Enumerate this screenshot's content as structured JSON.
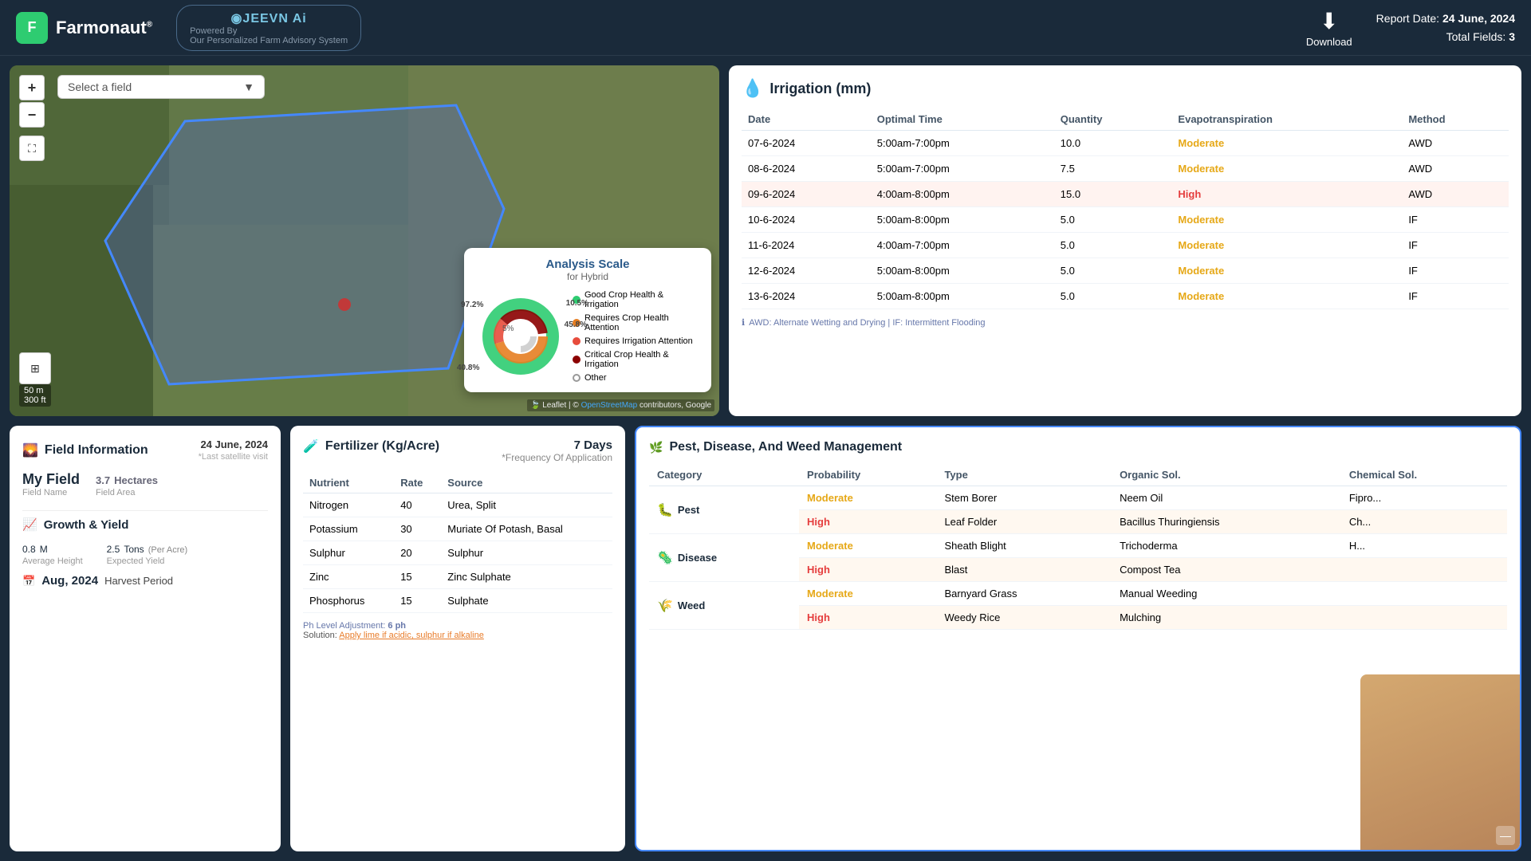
{
  "header": {
    "logo_letter": "F",
    "brand_name": "Farmonaut",
    "brand_reg": "®",
    "jeevn_label": "◉JEEVN Ai",
    "jeevn_powered": "Powered By",
    "jeevn_tagline": "Our Personalized Farm Advisory System",
    "download_label": "Download",
    "report_date_label": "Report Date:",
    "report_date_value": "24 June, 2024",
    "total_fields_label": "Total Fields:",
    "total_fields_value": "3"
  },
  "map": {
    "field_select_placeholder": "Select a field",
    "zoom_in": "+",
    "zoom_out": "−",
    "scale_m": "50 m",
    "scale_ft": "300 ft",
    "attribution": "Leaflet | © OpenStreetMap contributors, Google"
  },
  "analysis_scale": {
    "title": "Analysis Scale",
    "subtitle": "for Hybrid",
    "pct_972": "97.2%",
    "pct_105": "10.5%",
    "pct_458": "45.8%",
    "pct_408": "40.8%",
    "pct_5": "5%",
    "legend": [
      {
        "color": "#2ecc71",
        "label": "Good Crop Health & Irrigation"
      },
      {
        "color": "#e67e22",
        "label": "Requires Crop Health Attention"
      },
      {
        "color": "#e74c3c",
        "label": "Requires Irrigation Attention"
      },
      {
        "color": "#c0392b",
        "label": "Critical Crop Health & Irrigation"
      },
      {
        "color": "#cccccc",
        "label": "Other"
      }
    ]
  },
  "irrigation": {
    "title": "Irrigation (mm)",
    "icon": "💧",
    "columns": [
      "Date",
      "Optimal Time",
      "Quantity",
      "Evapotranspiration",
      "Method"
    ],
    "rows": [
      {
        "date": "07-6-2024",
        "time": "5:00am-7:00pm",
        "qty": "10.0",
        "evap": "Moderate",
        "method": "AWD",
        "highlight": false
      },
      {
        "date": "08-6-2024",
        "time": "5:00am-7:00pm",
        "qty": "7.5",
        "evap": "Moderate",
        "method": "AWD",
        "highlight": false
      },
      {
        "date": "09-6-2024",
        "time": "4:00am-8:00pm",
        "qty": "15.0",
        "evap": "High",
        "method": "AWD",
        "highlight": true
      },
      {
        "date": "10-6-2024",
        "time": "5:00am-8:00pm",
        "qty": "5.0",
        "evap": "Moderate",
        "method": "IF",
        "highlight": false
      },
      {
        "date": "11-6-2024",
        "time": "4:00am-7:00pm",
        "qty": "5.0",
        "evap": "Moderate",
        "method": "IF",
        "highlight": false
      },
      {
        "date": "12-6-2024",
        "time": "5:00am-8:00pm",
        "qty": "5.0",
        "evap": "Moderate",
        "method": "IF",
        "highlight": false
      },
      {
        "date": "13-6-2024",
        "time": "5:00am-8:00pm",
        "qty": "5.0",
        "evap": "Moderate",
        "method": "IF",
        "highlight": false
      }
    ],
    "note": "AWD: Alternate Wetting and Drying | IF: Intermittent Flooding"
  },
  "field_info": {
    "title": "Field Information",
    "icon": "🌄",
    "date_label": "24 June, 2024",
    "date_sub": "*Last satellite visit",
    "field_name_label": "My Field",
    "field_name_sub": "Field Name",
    "area_value": "3.7",
    "area_unit": "Hectares",
    "area_sub": "Field Area"
  },
  "growth": {
    "title": "Growth & Yield",
    "icon": "📈",
    "height_val": "0.8",
    "height_unit": "M",
    "height_label": "Average Height",
    "yield_val": "2.5",
    "yield_unit": "Tons",
    "yield_per": "(Per Acre)",
    "yield_label": "Expected Yield",
    "harvest_date": "Aug, 2024",
    "harvest_label": "Harvest Period"
  },
  "fertilizer": {
    "title": "Fertilizer (Kg/Acre)",
    "icon": "🧪",
    "freq_val": "7 Days",
    "freq_label": "*Frequency Of Application",
    "columns": [
      "Nutrient",
      "Rate",
      "Source"
    ],
    "rows": [
      {
        "nutrient": "Nitrogen",
        "rate": "40",
        "source": "Urea, Split"
      },
      {
        "nutrient": "Potassium",
        "rate": "30",
        "source": "Muriate Of Potash, Basal"
      },
      {
        "nutrient": "Sulphur",
        "rate": "20",
        "source": "Sulphur"
      },
      {
        "nutrient": "Zinc",
        "rate": "15",
        "source": "Zinc Sulphate"
      },
      {
        "nutrient": "Phosphorus",
        "rate": "15",
        "source": "Sulphate"
      }
    ],
    "ph_note": "Ph Level Adjustment: 6 ph",
    "solution_label": "Solution:",
    "solution_text": "Apply lime if acidic, sulphur if alkaline"
  },
  "pest": {
    "title": "Pest, Disease, And Weed Management",
    "icon": "🌿",
    "columns": [
      "Category",
      "Probability",
      "Type",
      "Organic Sol.",
      "Chemical Sol."
    ],
    "categories": [
      {
        "name": "Pest",
        "icon": "🐛",
        "color": "#e74c3c",
        "rows": [
          {
            "prob": "Moderate",
            "type": "Stem Borer",
            "organic": "Neem Oil",
            "chemical": "Fipro...",
            "highlight": false
          },
          {
            "prob": "High",
            "type": "Leaf Folder",
            "organic": "Bacillus Thuringiensis",
            "chemical": "Ch...",
            "highlight": true
          }
        ]
      },
      {
        "name": "Disease",
        "icon": "🦠",
        "color": "#9b59b6",
        "rows": [
          {
            "prob": "Moderate",
            "type": "Sheath Blight",
            "organic": "Trichoderma",
            "chemical": "H...",
            "highlight": false
          },
          {
            "prob": "High",
            "type": "Blast",
            "organic": "Compost Tea",
            "chemical": "",
            "highlight": true
          }
        ]
      },
      {
        "name": "Weed",
        "icon": "🌾",
        "color": "#27ae60",
        "rows": [
          {
            "prob": "Moderate",
            "type": "Barnyard Grass",
            "organic": "Manual Weeding",
            "chemical": "",
            "highlight": false
          },
          {
            "prob": "High",
            "type": "Weedy Rice",
            "organic": "Mulching",
            "chemical": "",
            "highlight": true
          }
        ]
      }
    ]
  }
}
